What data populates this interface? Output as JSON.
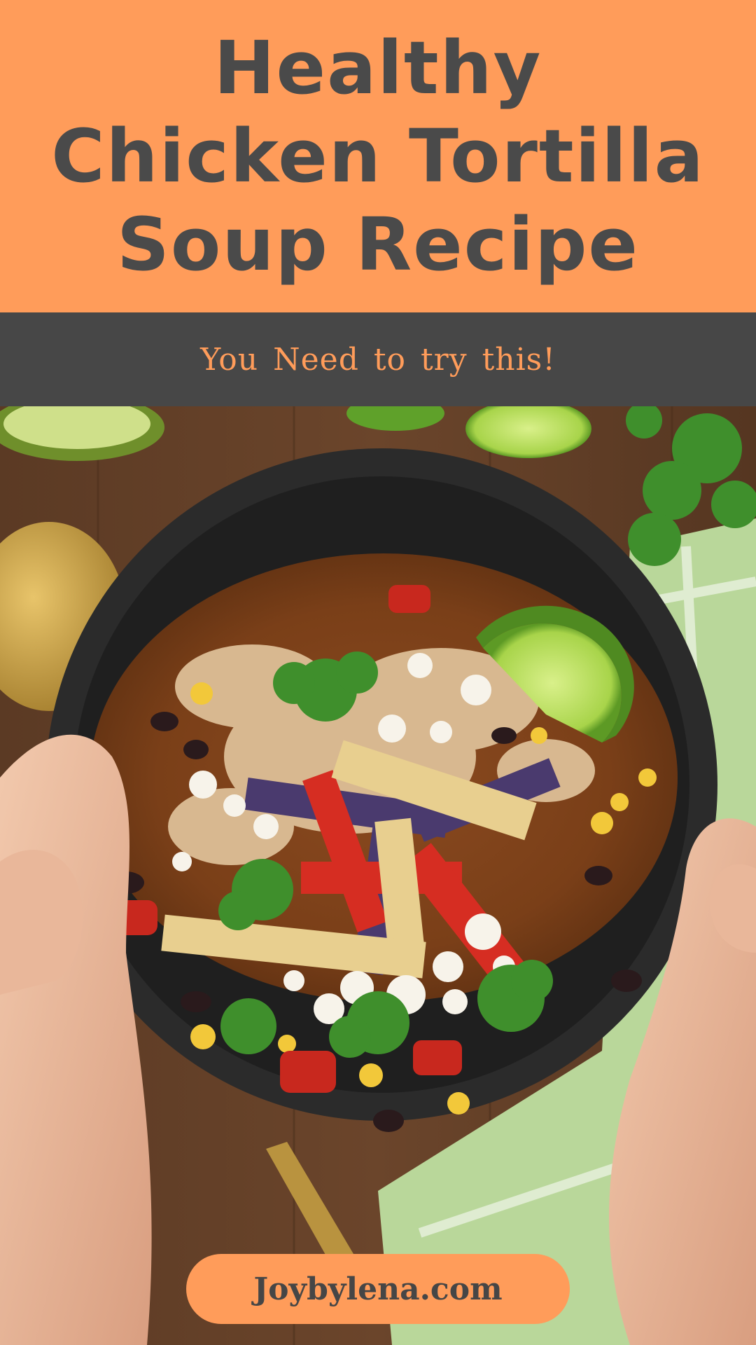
{
  "header": {
    "title_lines": [
      "Healthy",
      "Chicken Tortilla",
      "Soup Recipe"
    ],
    "subtitle": "You Need to try this!"
  },
  "footer": {
    "website": "Joybylena.com"
  },
  "colors": {
    "accent_orange": "#ff9c5a",
    "dark_gray": "#474747",
    "text_gray": "#4a4a4a"
  },
  "photo": {
    "alt": "Hands holding a bowl of chicken tortilla soup topped with tortilla strips, cotija cheese, cilantro and a lime wedge"
  }
}
